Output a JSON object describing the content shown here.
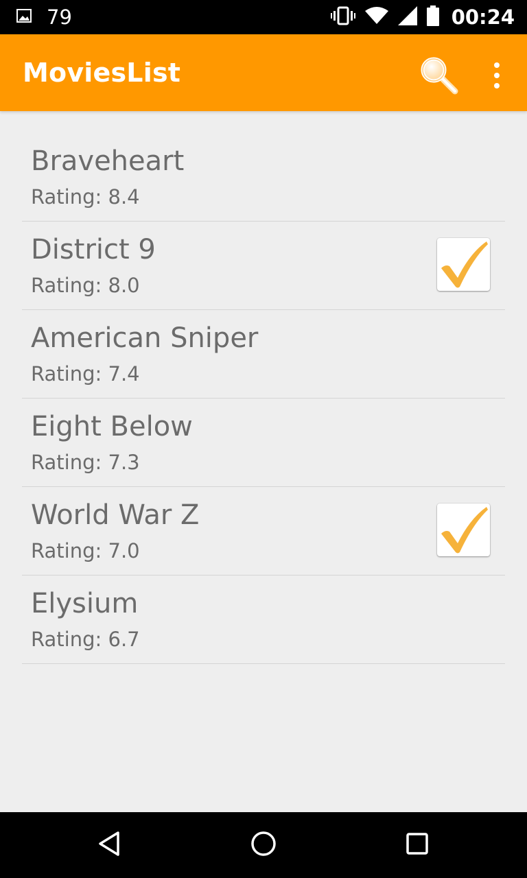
{
  "status_bar": {
    "left_icon": "image-notification-icon",
    "notification_count": "79",
    "icons": [
      "vibrate-icon",
      "wifi-icon",
      "signal-icon",
      "battery-icon"
    ],
    "time": "00:24"
  },
  "app_bar": {
    "title": "MoviesList",
    "background_color": "#ff9800",
    "actions": [
      "search-icon",
      "overflow-menu-icon"
    ]
  },
  "movies": [
    {
      "title": "Braveheart",
      "rating": "Rating: 8.4",
      "checked": false
    },
    {
      "title": "District 9",
      "rating": "Rating: 8.0",
      "checked": true
    },
    {
      "title": "American Sniper",
      "rating": "Rating: 7.4",
      "checked": false
    },
    {
      "title": "Eight Below",
      "rating": "Rating: 7.3",
      "checked": false
    },
    {
      "title": "World War Z",
      "rating": "Rating: 7.0",
      "checked": true
    },
    {
      "title": "Elysium",
      "rating": "Rating: 6.7",
      "checked": false
    }
  ],
  "nav_bar": {
    "buttons": [
      "back-icon",
      "home-icon",
      "recents-icon"
    ]
  }
}
